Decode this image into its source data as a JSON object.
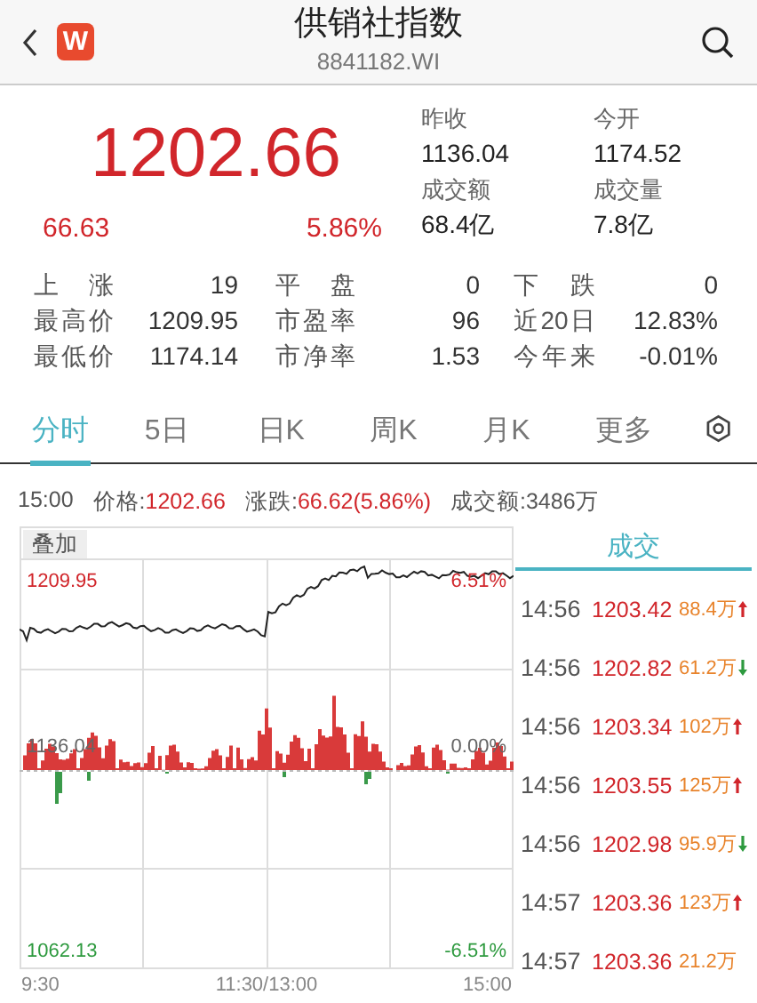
{
  "header": {
    "logo": "W",
    "title": "供销社指数",
    "code": "8841182.WI"
  },
  "quote": {
    "price": "1202.66",
    "change": "66.63",
    "change_pct": "5.86%",
    "fields": [
      {
        "label": "昨收",
        "value": "1136.04"
      },
      {
        "label": "今开",
        "value": "1174.52"
      },
      {
        "label": "成交额",
        "value": "68.4亿"
      },
      {
        "label": "成交量",
        "value": "7.8亿"
      }
    ]
  },
  "stats": [
    {
      "label": "上 涨",
      "value": "19"
    },
    {
      "label": "平 盘",
      "value": "0"
    },
    {
      "label": "下 跌",
      "value": "0"
    },
    {
      "label": "最高价",
      "value": "1209.95"
    },
    {
      "label": "市盈率",
      "value": "96"
    },
    {
      "label": "近20日",
      "value": "12.83%"
    },
    {
      "label": "最低价",
      "value": "1174.14"
    },
    {
      "label": "市净率",
      "value": "1.53"
    },
    {
      "label": "今年来",
      "value": "-0.01%"
    }
  ],
  "tabs": [
    {
      "label": "分时",
      "selected": true
    },
    {
      "label": "5日",
      "selected": false
    },
    {
      "label": "日K",
      "selected": false
    },
    {
      "label": "周K",
      "selected": false
    },
    {
      "label": "月K",
      "selected": false
    },
    {
      "label": "更多",
      "selected": false
    }
  ],
  "info": {
    "time": "15:00",
    "price_label": "价格:",
    "price": "1202.66",
    "change_label": "涨跌:",
    "change": "66.62(5.86%)",
    "amount_label": "成交额:",
    "amount": "3486万"
  },
  "chart": {
    "overlay_button": "叠加",
    "y_max": "1209.95",
    "pct_max": "6.51%",
    "y_mid": "1136.04",
    "pct_mid": "0.00%",
    "y_min": "1062.13",
    "pct_min": "-6.51%",
    "x_labels": [
      "9:30",
      "11:30/13:00",
      "15:00"
    ]
  },
  "trades": {
    "title": "成交",
    "rows": [
      {
        "time": "14:56",
        "price": "1203.42",
        "volume": "88.4万",
        "kind": "up"
      },
      {
        "time": "14:56",
        "price": "1202.82",
        "volume": "61.2万",
        "kind": "down"
      },
      {
        "time": "14:56",
        "price": "1203.34",
        "volume": "102万",
        "kind": "up"
      },
      {
        "time": "14:56",
        "price": "1203.55",
        "volume": "125万",
        "kind": "up"
      },
      {
        "time": "14:56",
        "price": "1202.98",
        "volume": "95.9万",
        "kind": "down"
      },
      {
        "time": "14:57",
        "price": "1203.36",
        "volume": "123万",
        "kind": "up"
      },
      {
        "time": "14:57",
        "price": "1203.36",
        "volume": "21.2万",
        "kind": "plain"
      }
    ]
  }
}
